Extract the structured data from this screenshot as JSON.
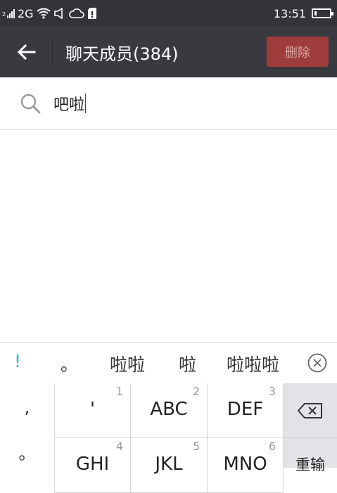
{
  "status": {
    "sim": "2",
    "network": "2G",
    "time": "13:51"
  },
  "header": {
    "title": "聊天成员(384)",
    "delete_label": "删除"
  },
  "search": {
    "query": "吧啦"
  },
  "candidates": [
    "!",
    "。",
    "啦啦",
    "啦",
    "啦啦啦"
  ],
  "keyboard": {
    "left_symbols": [
      ",",
      "。"
    ],
    "keys": [
      {
        "num": "1",
        "label": "'"
      },
      {
        "num": "2",
        "label": "ABC"
      },
      {
        "num": "3",
        "label": "DEF"
      },
      {
        "num": "4",
        "label": "GHI"
      },
      {
        "num": "5",
        "label": "JKL"
      },
      {
        "num": "6",
        "label": "MNO"
      }
    ],
    "reinput_label": "重输"
  },
  "colors": {
    "status_bar": "#333438",
    "title_bar": "#393a3f",
    "delete_button": "#9e3c3c",
    "candidate_accent": "#2bbfa8"
  }
}
